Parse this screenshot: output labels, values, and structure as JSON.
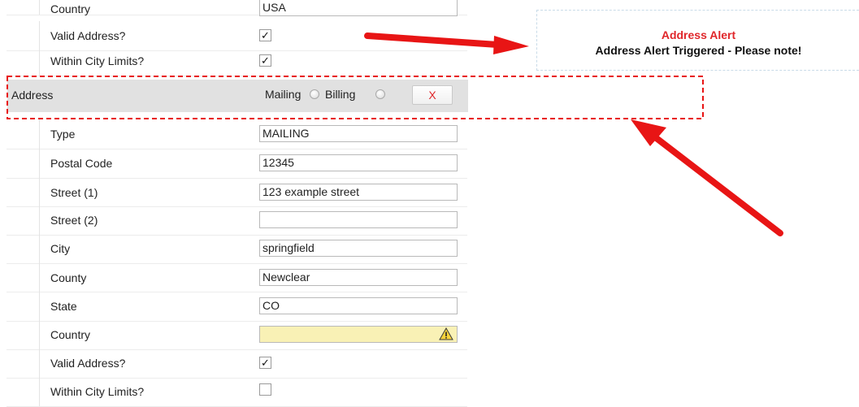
{
  "top_rows": {
    "country": {
      "label": "Country",
      "value": "USA"
    },
    "valid_address": {
      "label": "Valid Address?",
      "checked": true,
      "check_glyph": "✓"
    },
    "within_city_limits": {
      "label": "Within City Limits?",
      "checked": true,
      "check_glyph": "✓"
    }
  },
  "address_section": {
    "title": "Address",
    "mailing_label": "Mailing",
    "billing_label": "Billing",
    "remove_label": "X"
  },
  "fields": {
    "type": {
      "label": "Type",
      "value": "MAILING"
    },
    "postal_code": {
      "label": "Postal Code",
      "value": "12345"
    },
    "street1": {
      "label": "Street (1)",
      "value": "123 example street"
    },
    "street2": {
      "label": "Street (2)",
      "value": ""
    },
    "city": {
      "label": "City",
      "value": "springfield"
    },
    "county": {
      "label": "County",
      "value": "Newclear"
    },
    "state": {
      "label": "State",
      "value": "CO"
    },
    "country": {
      "label": "Country",
      "value": "",
      "icon": "warning-icon"
    },
    "valid_address": {
      "label": "Valid Address?",
      "checked": true,
      "check_glyph": "✓"
    },
    "within_city_limits": {
      "label": "Within City Limits?",
      "checked": false,
      "check_glyph": ""
    }
  },
  "alert": {
    "title": "Address Alert",
    "message": "Address Alert Triggered - Please note!"
  },
  "colors": {
    "alert_red": "#e0262a",
    "warning_yellow": "#f9f1b5",
    "section_gray": "#e1e1e1",
    "arrow_red": "#e81515"
  }
}
